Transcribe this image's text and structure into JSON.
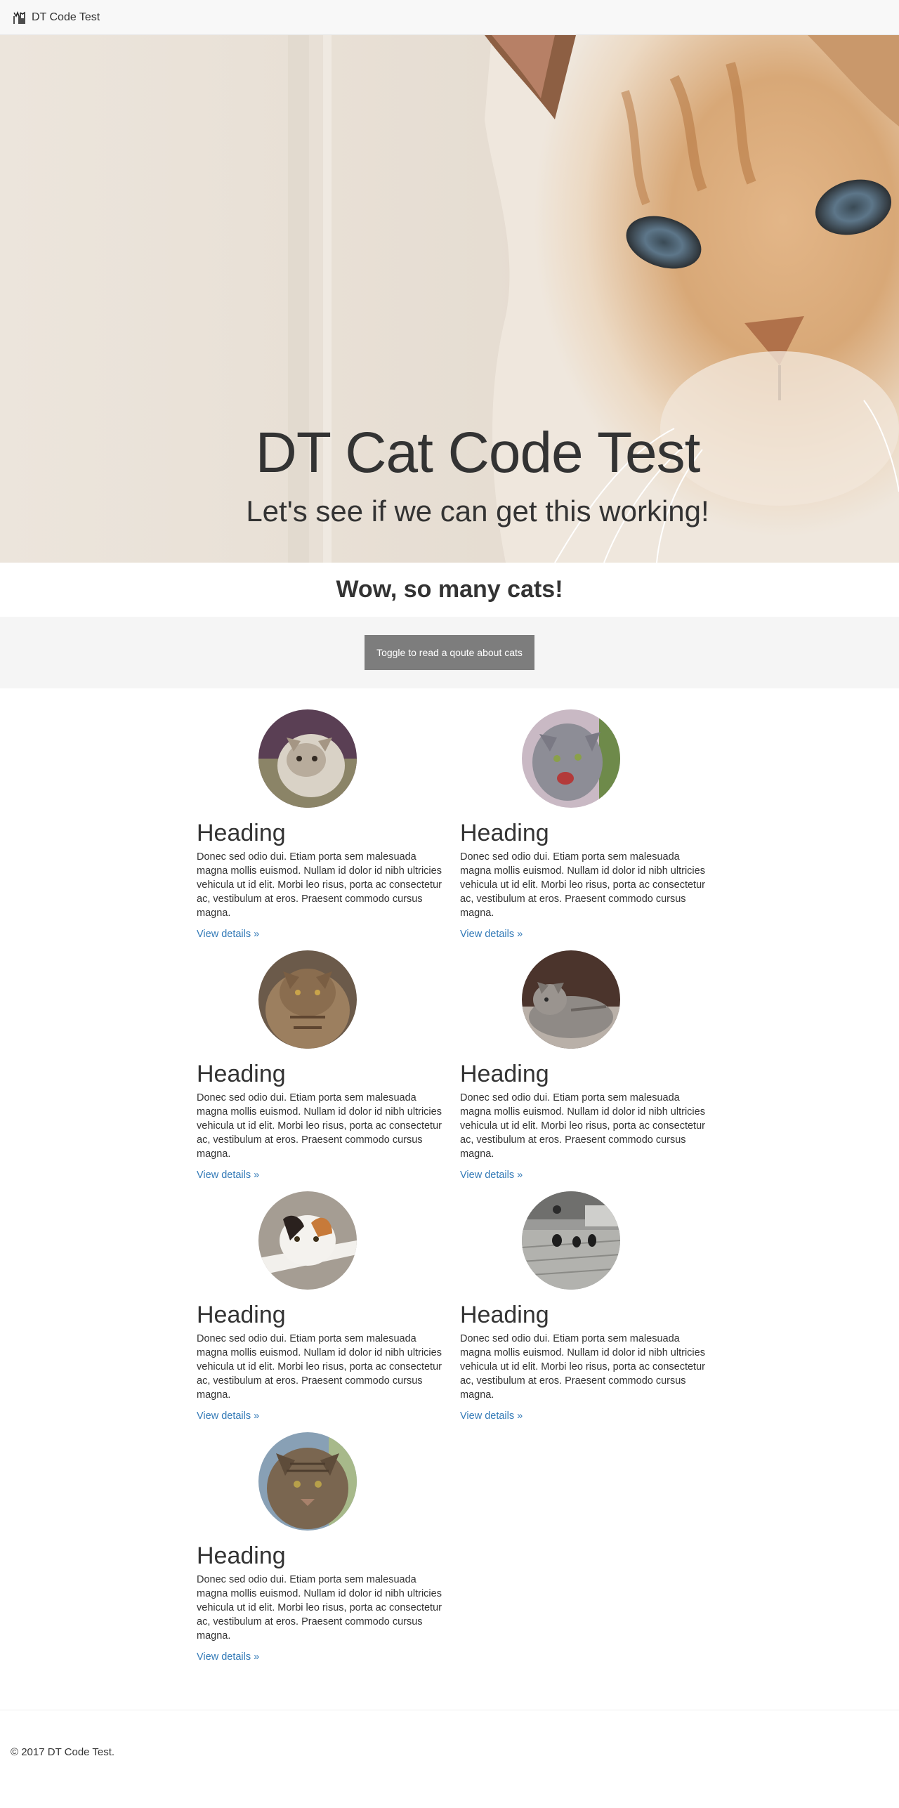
{
  "navbar": {
    "brand_icon": "cat-logo-icon",
    "brand": "DT Code Test"
  },
  "hero": {
    "title": "DT Cat Code Test",
    "subtitle": "Let's see if we can get this working!",
    "image": "cat-face-photo"
  },
  "section": {
    "heading": "Wow, so many cats!"
  },
  "toggle": {
    "label": "Toggle to read a qoute about cats"
  },
  "cards": [
    {
      "heading": "Heading",
      "text": "Donec sed odio dui. Etiam porta sem malesuada magna mollis euismod. Nullam id dolor id nibh ultricies vehicula ut id elit. Morbi leo risus, porta ac consectetur ac, vestibulum at eros. Praesent commodo cursus magna.",
      "link": "View details »",
      "image": "fluffy-cat-photo"
    },
    {
      "heading": "Heading",
      "text": "Donec sed odio dui. Etiam porta sem malesuada magna mollis euismod. Nullam id dolor id nibh ultricies vehicula ut id elit. Morbi leo risus, porta ac consectetur ac, vestibulum at eros. Praesent commodo cursus magna.",
      "link": "View details »",
      "image": "hissing-gray-cat-photo"
    },
    {
      "heading": "Heading",
      "text": "Donec sed odio dui. Etiam porta sem malesuada magna mollis euismod. Nullam id dolor id nibh ultricies vehicula ut id elit. Morbi leo risus, porta ac consectetur ac, vestibulum at eros. Praesent commodo cursus magna.",
      "link": "View details »",
      "image": "tabby-cat-photo"
    },
    {
      "heading": "Heading",
      "text": "Donec sed odio dui. Etiam porta sem malesuada magna mollis euismod. Nullam id dolor id nibh ultricies vehicula ut id elit. Morbi leo risus, porta ac consectetur ac, vestibulum at eros. Praesent commodo cursus magna.",
      "link": "View details »",
      "image": "lying-gray-cat-photo"
    },
    {
      "heading": "Heading",
      "text": "Donec sed odio dui. Etiam porta sem malesuada magna mollis euismod. Nullam id dolor id nibh ultricies vehicula ut id elit. Morbi leo risus, porta ac consectetur ac, vestibulum at eros. Praesent commodo cursus magna.",
      "link": "View details »",
      "image": "calico-cat-photo"
    },
    {
      "heading": "Heading",
      "text": "Donec sed odio dui. Etiam porta sem malesuada magna mollis euismod. Nullam id dolor id nibh ultricies vehicula ut id elit. Morbi leo risus, porta ac consectetur ac, vestibulum at eros. Praesent commodo cursus magna.",
      "link": "View details »",
      "image": "street-cats-photo"
    },
    {
      "heading": "Heading",
      "text": "Donec sed odio dui. Etiam porta sem malesuada magna mollis euismod. Nullam id dolor id nibh ultricies vehicula ut id elit. Morbi leo risus, porta ac consectetur ac, vestibulum at eros. Praesent commodo cursus magna.",
      "link": "View details »",
      "image": "maine-coon-cat-photo"
    }
  ],
  "footer": {
    "text": "© 2017 DT Code Test."
  }
}
